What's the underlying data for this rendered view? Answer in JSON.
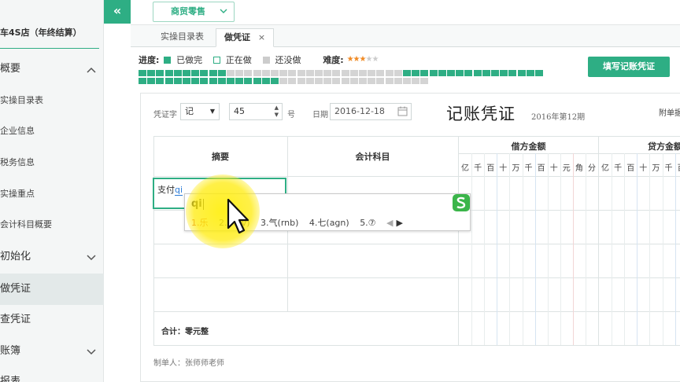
{
  "sidebar": {
    "company": "车4S店（年终结算）",
    "items": [
      {
        "label": "概要",
        "chevron": "up"
      },
      {
        "label": "实操目录表"
      },
      {
        "label": "企业信息"
      },
      {
        "label": "税务信息"
      },
      {
        "label": "实操重点"
      },
      {
        "label": "会计科目概要"
      },
      {
        "label": "初始化",
        "chevron": "down"
      },
      {
        "label": "做凭证",
        "active": true
      },
      {
        "label": "查凭证"
      },
      {
        "label": "账簿",
        "chevron": "down"
      },
      {
        "label": "报表"
      }
    ]
  },
  "topbar": {
    "collapse_icon": "«",
    "industry_select": "商贸零售"
  },
  "tabs": [
    {
      "label": "实操目录表"
    },
    {
      "label": "做凭证",
      "close": "×",
      "active": true
    }
  ],
  "progress": {
    "label": "进度:",
    "legend_done": "已做完",
    "legend_doing": "正在做",
    "legend_todo": "还没做",
    "difficulty_label": "难度:",
    "difficulty": 3,
    "difficulty_max": 5,
    "done_color": "#2eae84"
  },
  "fill_button": "填写记账凭证",
  "voucher": {
    "word_label": "凭证字",
    "word_value": "记",
    "number_value": "45",
    "number_suffix": "号",
    "date_label": "日期",
    "date_value": "2016-12-18",
    "title": "记账凭证",
    "period": "2016年第12期",
    "attachment": "附单据",
    "col_summary": "摘要",
    "col_account": "会计科目",
    "col_debit": "借方金额",
    "col_credit": "贷方金额",
    "digits": [
      "亿",
      "千",
      "百",
      "十",
      "万",
      "千",
      "百",
      "十",
      "元",
      "角",
      "分"
    ],
    "credit_digits_visible": [
      "亿",
      "千",
      "百",
      "十",
      "万",
      "千",
      "百"
    ],
    "total_label": "合计：零元整",
    "maker": "制单人：张师师老师",
    "summary_value": "支付",
    "summary_pinyin": "qi"
  },
  "ime": {
    "input": "qi",
    "candidates": [
      "1.乐",
      "2.(hnv)",
      "3.气(rnb)",
      "4.七(agn)",
      "5.⑦"
    ],
    "nav": "◀ ▶"
  }
}
